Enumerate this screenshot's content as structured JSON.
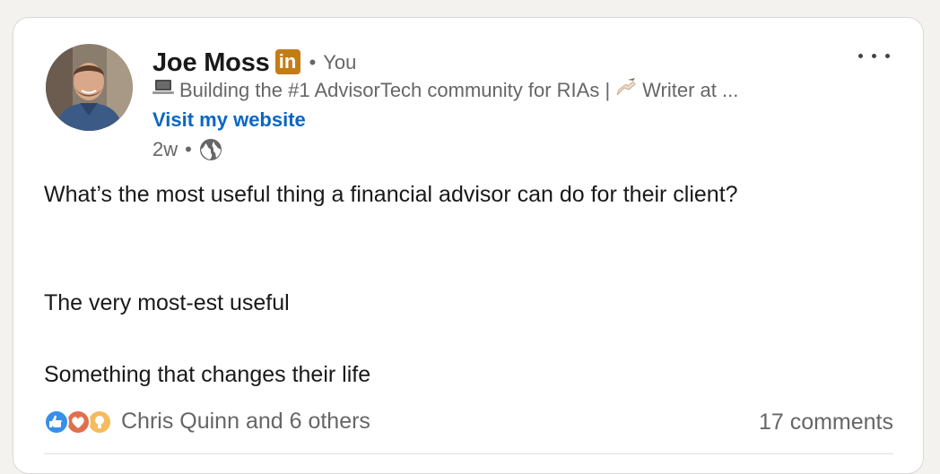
{
  "post": {
    "author": {
      "name": "Joe Moss",
      "badge": "in",
      "relation_separator": "•",
      "relation": "You",
      "headline": "Building the #1 AdvisorTech community for RIAs | ✍🏻 Writer at ...",
      "headline_part1": "Building the #1 AdvisorTech community for RIAs |",
      "headline_part2": "Writer at ...",
      "website_link": "Visit my website"
    },
    "time": "2w",
    "time_separator": "•",
    "visibility_icon": "globe-icon",
    "content_lines": [
      "What’s the most useful thing a financial advisor can do for their client?",
      "The very most-est useful",
      "Something that changes their life"
    ],
    "reactions": {
      "icons": [
        "like-icon",
        "love-icon",
        "insightful-icon"
      ],
      "text": "Chris Quinn and 6 others"
    },
    "comments": "17 comments",
    "more_icon": "more-options-icon"
  },
  "colors": {
    "link": "#0a66c2",
    "badge": "#c37d16",
    "secondary_text": "#666666",
    "like": "#378fe9",
    "love": "#df704d",
    "insightful": "#f5bb5c"
  }
}
